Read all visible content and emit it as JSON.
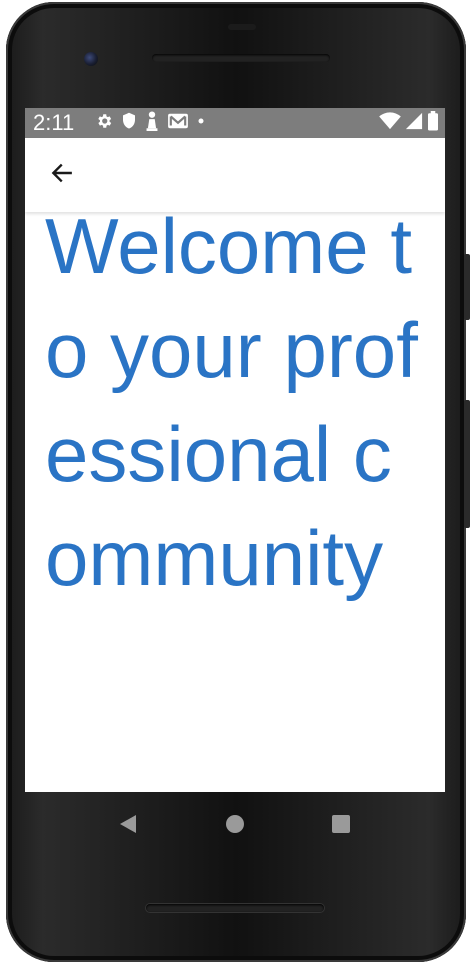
{
  "status_bar": {
    "time": "2:11",
    "left_icons": [
      "settings-icon",
      "shield-icon",
      "pawn-icon",
      "gmail-icon",
      "dot-icon"
    ],
    "right_icons": [
      "wifi-icon",
      "cell-signal-icon",
      "battery-icon"
    ]
  },
  "app_bar": {
    "back_icon": "arrow-back-icon"
  },
  "main": {
    "headline": "Welcome to your professional community"
  },
  "nav_bar": {
    "buttons": [
      "back-triangle-icon",
      "home-circle-icon",
      "recents-square-icon"
    ]
  },
  "colors": {
    "headline": "#2a74c5",
    "status_bar_bg": "#7d7d7d",
    "screen_bg": "#ffffff",
    "device_body": "#111111"
  }
}
